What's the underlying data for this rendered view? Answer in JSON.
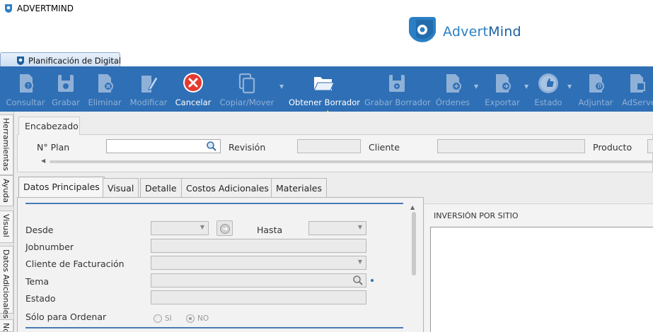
{
  "app": {
    "title": "ADVERTMIND",
    "logo_text_a": "Advert",
    "logo_text_b": "Mind"
  },
  "doc_tab": {
    "label": "Planificación de Digital"
  },
  "toolbar": {
    "consultar": "Consultar",
    "grabar": "Grabar",
    "eliminar": "Eliminar",
    "modificar": "Modificar",
    "cancelar": "Cancelar",
    "copiar_mover": "Copiar/Mover",
    "obtener_borrador": "Obtener Borrador",
    "grabar_borrador": "Grabar Borrador",
    "ordenes": "Órdenes",
    "exportar": "Exportar",
    "estado": "Estado",
    "adjuntar": "Adjuntar",
    "adserver": "AdServer"
  },
  "side_tabs": {
    "herramientas": "Herramientas",
    "ayuda": "Ayuda",
    "visual": "Visual",
    "datos_adicionales": "Datos Adicionales",
    "extra": "No"
  },
  "header": {
    "tab": "Encabezado",
    "plan_label": "N° Plan",
    "revision_label": "Revisión",
    "cliente_label": "Cliente",
    "producto_label": "Producto",
    "plan_value": "",
    "revision_value": "",
    "cliente_value": ""
  },
  "tabs": {
    "datos": "Datos Principales",
    "visual": "Visual",
    "detalle": "Detalle",
    "costos": "Costos Adicionales",
    "materiales": "Materiales"
  },
  "form": {
    "desde": "Desde",
    "hasta": "Hasta",
    "jobnumber": "Jobnumber",
    "cliente_fact": "Cliente de Facturación",
    "tema": "Tema",
    "estado": "Estado",
    "solo_ordenar": "Sólo para Ordenar",
    "si": "SI",
    "no": "NO"
  },
  "inversion": {
    "title": "INVERSIÓN POR SITIO"
  },
  "colors": {
    "ribbon": "#2f6fb5",
    "cancel_red": "#e53a2f",
    "arrow_yellow": "#f5f500"
  }
}
